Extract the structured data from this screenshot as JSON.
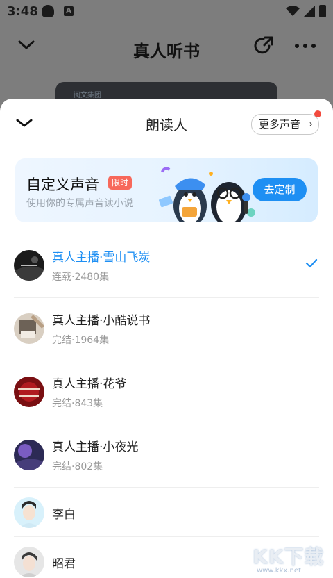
{
  "status_bar": {
    "time": "3:48",
    "a_label": "A"
  },
  "background": {
    "title": "真人听书",
    "cover_label": "阅文集团"
  },
  "sheet": {
    "title": "朗读人",
    "more_voices_label": "更多声音"
  },
  "banner": {
    "title": "自定义声音",
    "badge": "限时",
    "subtitle": "使用你的专属声音读小说",
    "cta": "去定制"
  },
  "voices": [
    {
      "name": "真人主播·雪山飞炭",
      "meta": "连载·2480集",
      "selected": true
    },
    {
      "name": "真人主播·小酷说书",
      "meta": "完结·1964集",
      "selected": false
    },
    {
      "name": "真人主播·花爷",
      "meta": "完结·843集",
      "selected": false
    },
    {
      "name": "真人主播·小夜光",
      "meta": "完结·802集",
      "selected": false
    },
    {
      "name": "李白",
      "meta": "",
      "selected": false
    },
    {
      "name": "昭君",
      "meta": "",
      "selected": false
    }
  ],
  "watermark": {
    "text": "KK下载",
    "url": "www.kkx.net"
  },
  "colors": {
    "accent": "#1e8ff3",
    "badge": "#f7685b",
    "dot": "#f24a3e"
  }
}
